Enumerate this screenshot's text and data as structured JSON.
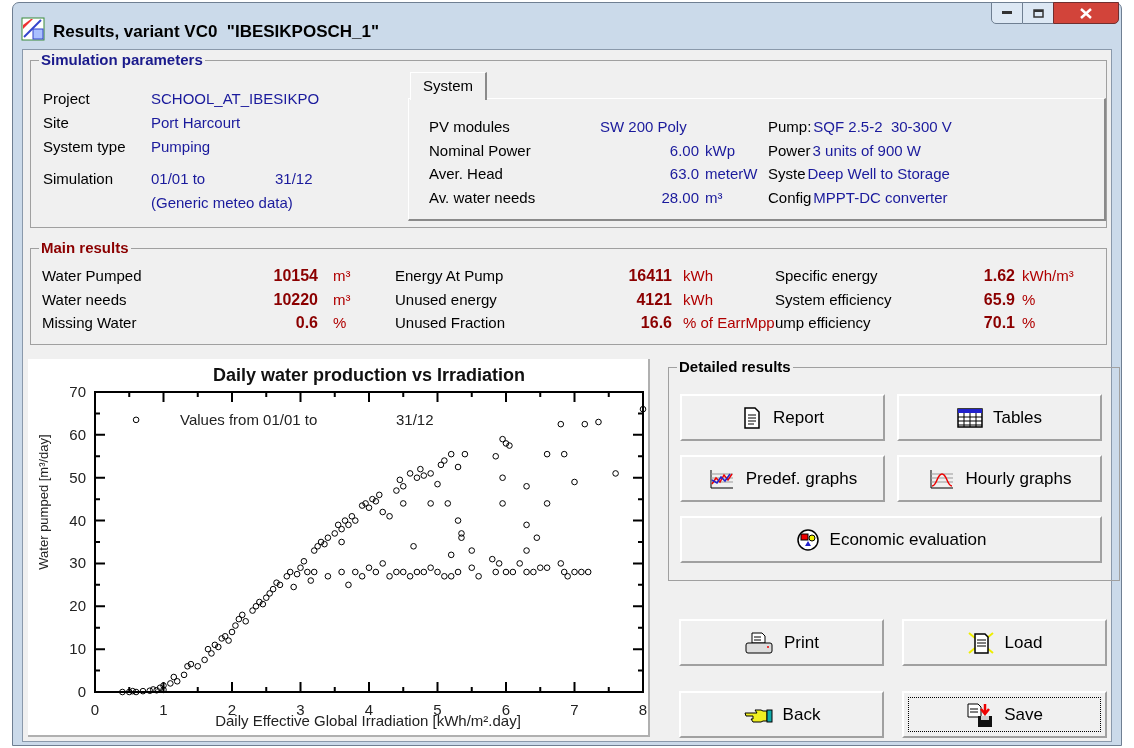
{
  "window": {
    "title": "Results, variant VC0  \"IBESIKPOSCH_1\""
  },
  "simulation_parameters": {
    "title": "Simulation parameters",
    "rows": [
      {
        "label": "Project",
        "value": "SCHOOL_AT_IBESIKPO"
      },
      {
        "label": "Site",
        "value": "Port Harcourt"
      },
      {
        "label": "System type",
        "value": "Pumping"
      },
      {
        "label": "Simulation",
        "value": "01/01 to",
        "value_2": "31/12"
      }
    ],
    "note": "(Generic meteo data)",
    "tabs": [
      {
        "label": "System",
        "selected": true
      }
    ],
    "system_rows": [
      {
        "label": "PV modules",
        "value": "SW 200 Poly",
        "label_2": "Pump:",
        "value_2": "SQF 2.5-2  30-300 V"
      },
      {
        "label": "Nominal Power",
        "value": "6.00",
        "unit": "kWp",
        "label_2": "Power",
        "value_2": "3 units of 900 W"
      },
      {
        "label": "Aver. Head",
        "value": "63.0",
        "unit": "meterW",
        "label_2": "Syste",
        "value_2": "Deep Well to Storage"
      },
      {
        "label": "Av. water needs",
        "value": "28.00",
        "unit": "m³",
        "label_2": "Config",
        "value_2": "MPPT-DC converter"
      }
    ]
  },
  "main_results": {
    "title": "Main results",
    "columns": [
      [
        {
          "label": "Water Pumped",
          "value": "10154",
          "unit": "m³"
        },
        {
          "label": "Water needs",
          "value": "10220",
          "unit": "m³"
        },
        {
          "label": "Missing Water",
          "value": "0.6",
          "unit": "%"
        }
      ],
      [
        {
          "label": "Energy At Pump",
          "value": "16411",
          "unit": "kWh"
        },
        {
          "label": "Unused energy",
          "value": "4121",
          "unit": "kWh"
        },
        {
          "label": "Unused Fraction",
          "value": "16.6",
          "unit": "% of EarrMpp"
        }
      ],
      [
        {
          "label": "Specific energy",
          "value": "1.62",
          "unit": "kWh/m³"
        },
        {
          "label": "System efficiency",
          "value": "65.9",
          "unit": "%"
        },
        {
          "label": "ump efficiency",
          "value": "70.1",
          "unit": "%"
        }
      ]
    ]
  },
  "chart": {
    "subtitle": "Values from 01/01 to",
    "subtitle_2": "31/12",
    "chart_data": {
      "type": "scatter",
      "title": "Daily water production vs Irradiation",
      "xlabel": "Daily Effective Global Irradiation [kWh/m².day]",
      "ylabel": "Water pumped [m³/day]",
      "xlim": [
        0,
        8
      ],
      "ylim": [
        0,
        70
      ],
      "xticks": [
        0,
        1,
        2,
        3,
        4,
        5,
        6,
        7,
        8
      ],
      "yticks": [
        0,
        10,
        20,
        30,
        40,
        50,
        60,
        70
      ],
      "x": [
        0.4,
        0.5,
        0.55,
        0.6,
        0.7,
        0.8,
        0.85,
        0.9,
        0.95,
        1.0,
        1.0,
        1.1,
        1.15,
        1.2,
        1.3,
        1.35,
        1.4,
        1.5,
        1.6,
        1.65,
        1.7,
        1.75,
        1.8,
        1.85,
        1.9,
        1.95,
        2.0,
        2.05,
        2.1,
        2.15,
        2.2,
        2.3,
        2.35,
        2.4,
        2.45,
        2.5,
        2.55,
        2.6,
        2.65,
        2.7,
        2.8,
        2.85,
        2.9,
        2.95,
        3.0,
        3.05,
        3.1,
        3.15,
        3.2,
        3.25,
        3.3,
        3.35,
        3.4,
        3.5,
        3.55,
        3.6,
        3.65,
        3.7,
        3.8,
        3.9,
        3.95,
        4.0,
        4.05,
        4.1,
        4.15,
        4.2,
        4.3,
        4.4,
        4.45,
        4.5,
        4.6,
        4.7,
        4.75,
        4.8,
        4.9,
        5.0,
        5.05,
        5.1,
        5.2,
        5.3,
        5.4,
        5.85,
        5.95,
        6.0,
        6.05,
        6.3,
        6.6,
        6.8,
        6.85,
        7.0,
        7.15,
        7.35,
        7.6,
        8.0,
        0.6,
        3.2,
        3.4,
        3.6,
        3.7,
        3.8,
        3.9,
        4.0,
        4.1,
        4.2,
        4.3,
        4.4,
        4.5,
        4.6,
        4.7,
        4.8,
        4.9,
        5.0,
        5.1,
        5.2,
        5.3,
        5.5,
        5.6,
        5.8,
        5.85,
        5.9,
        6.0,
        6.1,
        6.2,
        6.3,
        6.4,
        6.5,
        6.6,
        6.8,
        6.85,
        6.9,
        7.0,
        7.1,
        7.2,
        4.65,
        4.9,
        5.15,
        5.3,
        5.35,
        5.35,
        5.2,
        5.5,
        5.95,
        5.95,
        6.3,
        6.3,
        6.45,
        6.6,
        3.6,
        3.75,
        4.5
      ],
      "series": [
        {
          "color": "#000000",
          "values": [
            0,
            0,
            0.2,
            0,
            0.2,
            0.3,
            0.6,
            0.4,
            1,
            1.5,
            0.5,
            2,
            3.5,
            2.5,
            4,
            6,
            6.5,
            6,
            7.5,
            10,
            9,
            11,
            10.5,
            12.5,
            13,
            12,
            14,
            15.5,
            17,
            18,
            16.5,
            19,
            20,
            21,
            20.5,
            22,
            23,
            24,
            25.5,
            25,
            27,
            28,
            24.5,
            27.5,
            29,
            30.5,
            28,
            26,
            33,
            34,
            35,
            34.5,
            36,
            37,
            39,
            38,
            40,
            39,
            40,
            43.5,
            44,
            43,
            45,
            44.5,
            46,
            42,
            41,
            47,
            49.5,
            48,
            51,
            50,
            52,
            50.5,
            51,
            48.5,
            53,
            54,
            55.5,
            52.5,
            55.5,
            55,
            59,
            58,
            57.5,
            48,
            55.5,
            62.5,
            55.5,
            49,
            62.5,
            63,
            51,
            66,
            63.5,
            28,
            27,
            28,
            25,
            28,
            27,
            29,
            28,
            30,
            27,
            28,
            28,
            27,
            28,
            28,
            29,
            28,
            27,
            27,
            28,
            29,
            27,
            31,
            28,
            30,
            28,
            28,
            30,
            28,
            28,
            29,
            29,
            30,
            28,
            27,
            28,
            28,
            28,
            34,
            44,
            44,
            40,
            37,
            36,
            32,
            33,
            44,
            50,
            39,
            33,
            36,
            44,
            35,
            41,
            44
          ]
        }
      ]
    }
  },
  "detailed_results": {
    "title": "Detailed results",
    "buttons": [
      {
        "label": "Report"
      },
      {
        "label": "Tables"
      },
      {
        "label": "Predef. graphs"
      },
      {
        "label": "Hourly graphs"
      },
      {
        "label": "Economic evaluation"
      }
    ]
  },
  "buttons": [
    {
      "label": "Print",
      "focused": false
    },
    {
      "label": "Load",
      "focused": false
    },
    {
      "label": "Back",
      "focused": false
    },
    {
      "label": "Save",
      "focused": true
    }
  ]
}
